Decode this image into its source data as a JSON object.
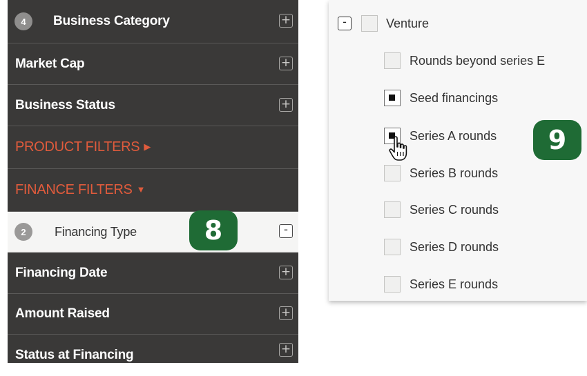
{
  "sidebar": {
    "business_category": {
      "badge": "4",
      "label": "Business Category",
      "button": "+"
    },
    "market_cap": {
      "label": "Market Cap",
      "button": "+"
    },
    "business_status": {
      "label": "Business Status",
      "button": "+"
    },
    "product_filters": {
      "label": "PRODUCT FILTERS",
      "indicator": "▶"
    },
    "finance_filters": {
      "label": "FINANCE FILTERS",
      "indicator": "▼"
    },
    "financing_type": {
      "badge": "2",
      "label": "Financing Type",
      "button": "-"
    },
    "financing_date": {
      "label": "Financing Date",
      "button": "+"
    },
    "amount_raised": {
      "label": "Amount Raised",
      "button": "+"
    },
    "status_at_financing": {
      "label": "Status at Financing",
      "button": "+"
    }
  },
  "step_badges": {
    "left": "8",
    "right": "9"
  },
  "panel": {
    "group": {
      "collapse": "-",
      "label": "Venture",
      "checked": false
    },
    "options": [
      {
        "label": "Rounds beyond series E",
        "checked": false
      },
      {
        "label": "Seed financings",
        "checked": true
      },
      {
        "label": "Series A rounds",
        "checked": true
      },
      {
        "label": "Series B rounds",
        "checked": false
      },
      {
        "label": "Series C rounds",
        "checked": false
      },
      {
        "label": "Series D rounds",
        "checked": false
      },
      {
        "label": "Series E rounds",
        "checked": false
      }
    ]
  },
  "colors": {
    "sidebar_bg": "#3a3938",
    "section_heading": "#e05b3c",
    "step_badge": "#1f6b35",
    "panel_bg": "#f7f7f7"
  },
  "icons": {
    "cursor": "hand-pointer-icon"
  }
}
